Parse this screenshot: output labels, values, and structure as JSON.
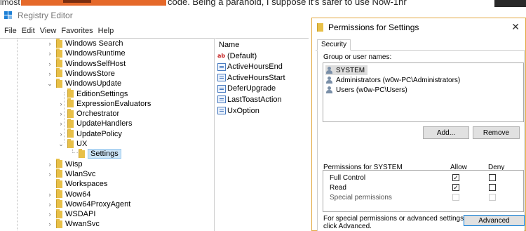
{
  "background": {
    "left_text": "lmost",
    "right_text": "code. Being a paranoid, I suppose it's safer to use Now-1hr"
  },
  "registry": {
    "title": "Registry Editor",
    "menu": [
      "File",
      "Edit",
      "View",
      "Favorites",
      "Help"
    ],
    "tree": [
      {
        "label": "Windows Search",
        "chev": "›"
      },
      {
        "label": "WindowsRuntime",
        "chev": "›"
      },
      {
        "label": "WindowsSelfHost",
        "chev": "›"
      },
      {
        "label": "WindowsStore",
        "chev": "›"
      },
      {
        "label": "WindowsUpdate",
        "chev": "⌄"
      },
      {
        "label": "EditionSettings",
        "chev": ""
      },
      {
        "label": "ExpressionEvaluators",
        "chev": "›"
      },
      {
        "label": "Orchestrator",
        "chev": "›"
      },
      {
        "label": "UpdateHandlers",
        "chev": "›"
      },
      {
        "label": "UpdatePolicy",
        "chev": "›"
      },
      {
        "label": "UX",
        "chev": "⌄"
      },
      {
        "label": "Settings",
        "chev": ""
      },
      {
        "label": "Wisp",
        "chev": "›"
      },
      {
        "label": "WlanSvc",
        "chev": "›"
      },
      {
        "label": "Workspaces",
        "chev": ""
      },
      {
        "label": "Wow64",
        "chev": "›"
      },
      {
        "label": "Wow64ProxyAgent",
        "chev": "›"
      },
      {
        "label": "WSDAPI",
        "chev": "›"
      },
      {
        "label": "WwanSvc",
        "chev": "›"
      }
    ],
    "values_header": "Name",
    "values": [
      {
        "name": "(Default)",
        "icon": "string-value-icon"
      },
      {
        "name": "ActiveHoursEnd",
        "icon": "binary-value-icon"
      },
      {
        "name": "ActiveHoursStart",
        "icon": "binary-value-icon"
      },
      {
        "name": "DeferUpgrade",
        "icon": "binary-value-icon"
      },
      {
        "name": "LastToastAction",
        "icon": "binary-value-icon"
      },
      {
        "name": "UxOption",
        "icon": "binary-value-icon"
      }
    ]
  },
  "dialog": {
    "title": "Permissions for Settings",
    "close": "✕",
    "tab": "Security",
    "group_label": "Group or user names:",
    "users": [
      "SYSTEM",
      "Administrators (w0w-PC\\Administrators)",
      "Users (w0w-PC\\Users)"
    ],
    "add_button": "Add...",
    "remove_button": "Remove",
    "perm_label": "Permissions for SYSTEM",
    "allow_header": "Allow",
    "deny_header": "Deny",
    "permissions": [
      {
        "name": "Full Control",
        "allow": true,
        "deny": false,
        "disabled": false
      },
      {
        "name": "Read",
        "allow": true,
        "deny": false,
        "disabled": false
      },
      {
        "name": "Special permissions",
        "allow": false,
        "deny": false,
        "disabled": true
      }
    ],
    "advanced_note_1": "For special permissions or advanced settings,",
    "advanced_note_2": "click Advanced.",
    "advanced_button": "Advanced"
  },
  "colors": {
    "accent_border": "#e2a840",
    "selection": "#cce4f7",
    "folder": "#e8c048"
  }
}
